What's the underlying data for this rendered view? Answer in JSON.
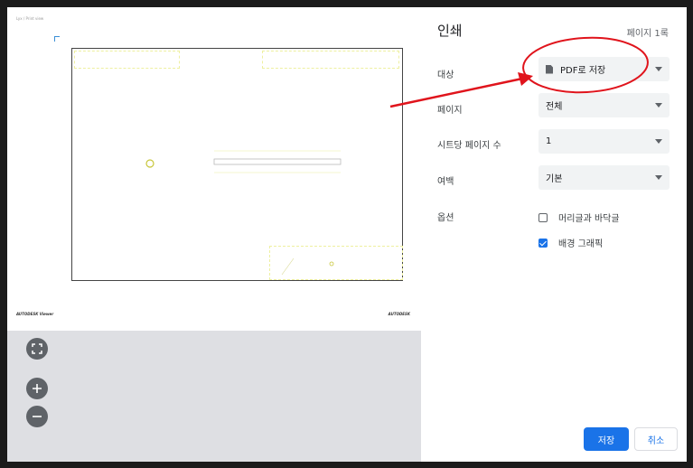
{
  "preview": {
    "header_text": "Lyx / Print view",
    "footer_left": "AUTODESK Viewer",
    "footer_right": "AUTODESK",
    "zoom_buttons": [
      "fit-to-page-icon",
      "zoom-in-icon",
      "zoom-out-icon"
    ]
  },
  "print_panel": {
    "title": "인쇄",
    "page_count": "페이지 1록",
    "destination": {
      "label": "대상",
      "value": "PDF로 저장",
      "icon": "document-icon"
    },
    "pages": {
      "label": "페이지",
      "value": "전체"
    },
    "pages_per_sheet": {
      "label": "시트당 페이지 수",
      "value": "1"
    },
    "margins": {
      "label": "여백",
      "value": "기본"
    },
    "options": {
      "label": "옵션",
      "headers_footers": {
        "label": "머리글과 바닥글",
        "checked": false
      },
      "background_graphics": {
        "label": "배경 그래픽",
        "checked": true
      }
    },
    "save_label": "저장",
    "cancel_label": "취소"
  },
  "colors": {
    "accent": "#1a73e8",
    "annotation": "#e0141c"
  }
}
